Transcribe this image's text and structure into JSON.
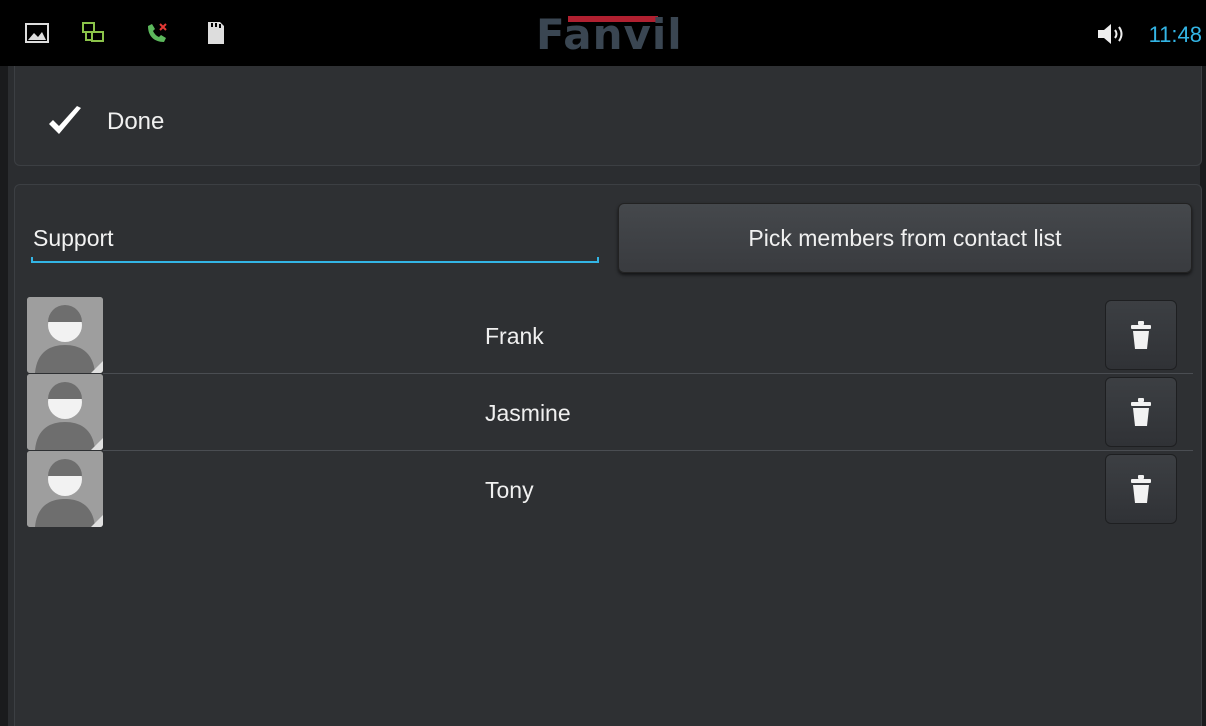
{
  "status_bar": {
    "icons": [
      "image-icon",
      "network-icon",
      "missed-call-icon",
      "sd-card-icon",
      "volume-icon"
    ],
    "logo": "Fanvil",
    "time": "11:48"
  },
  "action_bar": {
    "done_label": "Done"
  },
  "group_form": {
    "group_name": "Support",
    "pick_button_label": "Pick members from contact list"
  },
  "members": [
    {
      "name": "Frank"
    },
    {
      "name": "Jasmine"
    },
    {
      "name": "Tony"
    }
  ],
  "colors": {
    "accent": "#33b5e5",
    "background": "#2b2d30",
    "logo_bar": "#b02030"
  }
}
